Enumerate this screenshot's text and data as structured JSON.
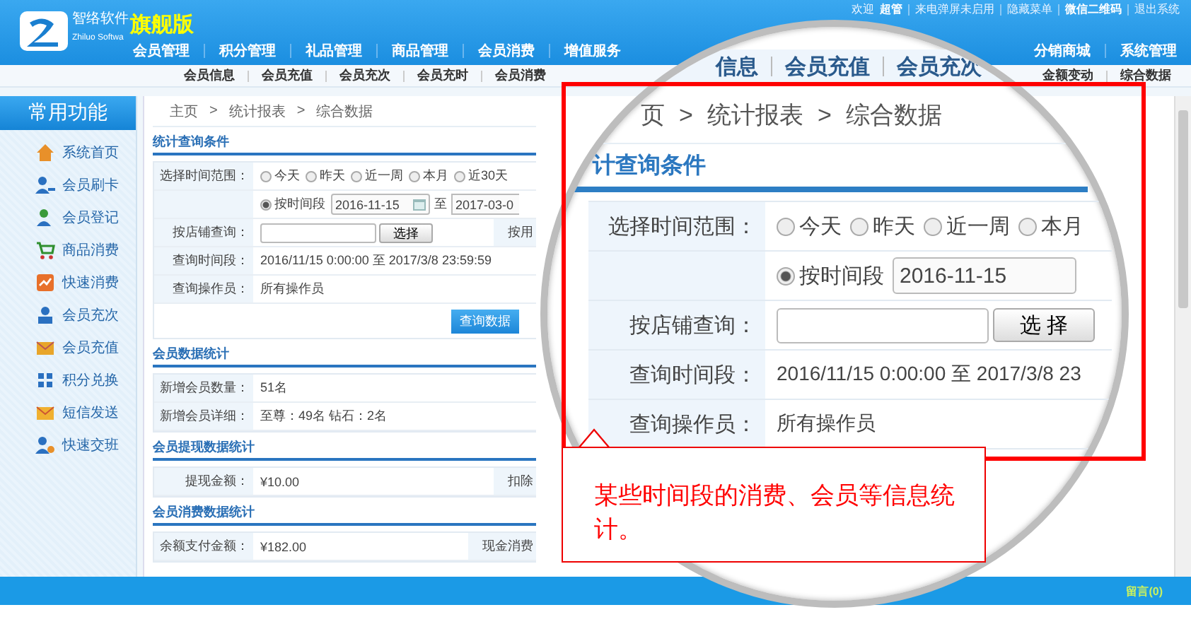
{
  "header": {
    "logo_title": "智络软件",
    "logo_subtitle": "Zhiluo Softwa",
    "edition": "旗舰版",
    "user_links": [
      {
        "text": "欢迎",
        "bold": false
      },
      {
        "text": "超管",
        "bold": true
      },
      {
        "text": "来电弹屏未启用",
        "bold": false
      },
      {
        "text": "隐藏菜单",
        "bold": false
      },
      {
        "text": "微信二维码",
        "bold": true
      },
      {
        "text": "退出系统",
        "bold": false
      }
    ]
  },
  "main_nav": {
    "left": [
      {
        "label": "会员管理",
        "selected": false
      },
      {
        "label": "积分管理",
        "selected": false
      },
      {
        "label": "礼品管理",
        "selected": false
      },
      {
        "label": "商品管理",
        "selected": false
      },
      {
        "label": "会员消费",
        "selected": false
      },
      {
        "label": "增值服务",
        "selected": false
      }
    ],
    "right": [
      {
        "label": "分销商城",
        "selected": false
      },
      {
        "label": "系统管理",
        "selected": false
      }
    ]
  },
  "sub_nav": {
    "left": [
      "会员信息",
      "会员充值",
      "会员充次",
      "会员充时",
      "会员消费"
    ],
    "right": [
      "金额变动",
      "综合数据"
    ]
  },
  "sidebar": {
    "title": "常用功能",
    "items": [
      "系统首页",
      "会员刷卡",
      "会员登记",
      "商品消费",
      "快速消费",
      "会员充次",
      "会员充值",
      "积分兑换",
      "短信发送",
      "快速交班"
    ]
  },
  "breadcrumb": [
    "主页",
    ">",
    "统计报表",
    ">",
    "综合数据"
  ],
  "query_conditions": {
    "title": "统计查询条件",
    "time_range": {
      "label": "选择时间范围：",
      "options": [
        {
          "label": "今天",
          "selected": false
        },
        {
          "label": "昨天",
          "selected": false
        },
        {
          "label": "近一周",
          "selected": false
        },
        {
          "label": "本月",
          "selected": false
        },
        {
          "label": "近30天",
          "selected": false
        }
      ]
    },
    "period": {
      "option": {
        "label": "按时间段",
        "selected": true
      },
      "start": "2016-11-15",
      "separator": "至",
      "end": "2017-03-0"
    },
    "shop": {
      "label": "按店铺查询：",
      "button": "选择",
      "extra_label": "按用"
    },
    "query_period": {
      "label": "查询时间段：",
      "value": "2016/11/15 0:00:00 至 2017/3/8 23:59:59"
    },
    "operator": {
      "label": "查询操作员：",
      "value": "所有操作员"
    },
    "submit": "查询数据"
  },
  "stat_sections": [
    {
      "title": "会员数据统计",
      "rows": [
        {
          "label": "新增会员数量：",
          "value": "51名"
        },
        {
          "label": "新增会员详细：",
          "value": "至尊：49名 钻石：2名"
        }
      ]
    },
    {
      "title": "会员提现数据统计",
      "rows": [
        {
          "label": "提现金额：",
          "value": "¥10.00",
          "extra_label": "扣除"
        }
      ]
    },
    {
      "title": "会员消费数据统计",
      "rows": [
        {
          "label": "余额支付金额：",
          "value": "¥182.00",
          "extra_label": "现金消费"
        }
      ]
    }
  ],
  "footer": {
    "message": "留言(0)"
  },
  "magnifier": {
    "nav": [
      "信息",
      "会员充值",
      "会员充次"
    ],
    "breadcrumb": [
      "页",
      ">",
      "统计报表",
      ">",
      "综合数据"
    ],
    "title": "计查询条件",
    "time_range": {
      "label": "选择时间范围：",
      "options": [
        {
          "label": "今天",
          "selected": false
        },
        {
          "label": "昨天",
          "selected": false
        },
        {
          "label": "近一周",
          "selected": false
        },
        {
          "label": "本月",
          "selected": false
        }
      ]
    },
    "period": {
      "option": {
        "label": "按时间段",
        "selected": true
      },
      "start": "2016-11-15"
    },
    "shop": {
      "label": "按店铺查询：",
      "button": "选 择"
    },
    "query_period": {
      "label": "查询时间段：",
      "value": "2016/11/15 0:00:00 至 2017/3/8 23"
    },
    "operator": {
      "label": "查询操作员：",
      "value": "所有操作员"
    }
  },
  "callout": {
    "text": "某些时间段的消费、会员等信息统计。"
  }
}
